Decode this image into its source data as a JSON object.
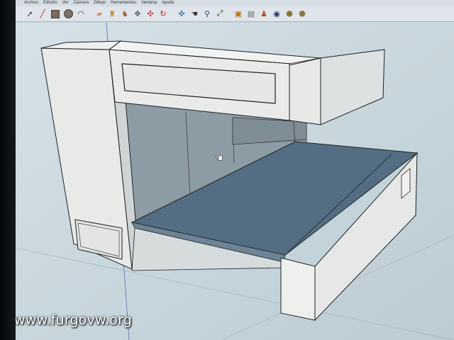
{
  "menu": {
    "items": [
      "Archivo",
      "Edición",
      "Ver",
      "Cámara",
      "Dibujo",
      "Herramientas",
      "Ventana",
      "Ayuda"
    ]
  },
  "toolbar": {
    "icons": [
      "select-icon",
      "pencil-icon",
      "rectangle-icon",
      "circle-icon",
      "arc-icon",
      "eraser-icon",
      "paint-bucket-icon",
      "push-pull-icon",
      "move-icon",
      "rotate-icon",
      "scale-icon",
      "orbit-icon",
      "pan-icon",
      "zoom-icon",
      "zoom-extents-icon",
      "component-icon",
      "section-icon",
      "walk-icon",
      "geo-icon",
      "warehouse-icon",
      "share-icon"
    ]
  },
  "watermark": {
    "text": "www.furgovw.org"
  }
}
